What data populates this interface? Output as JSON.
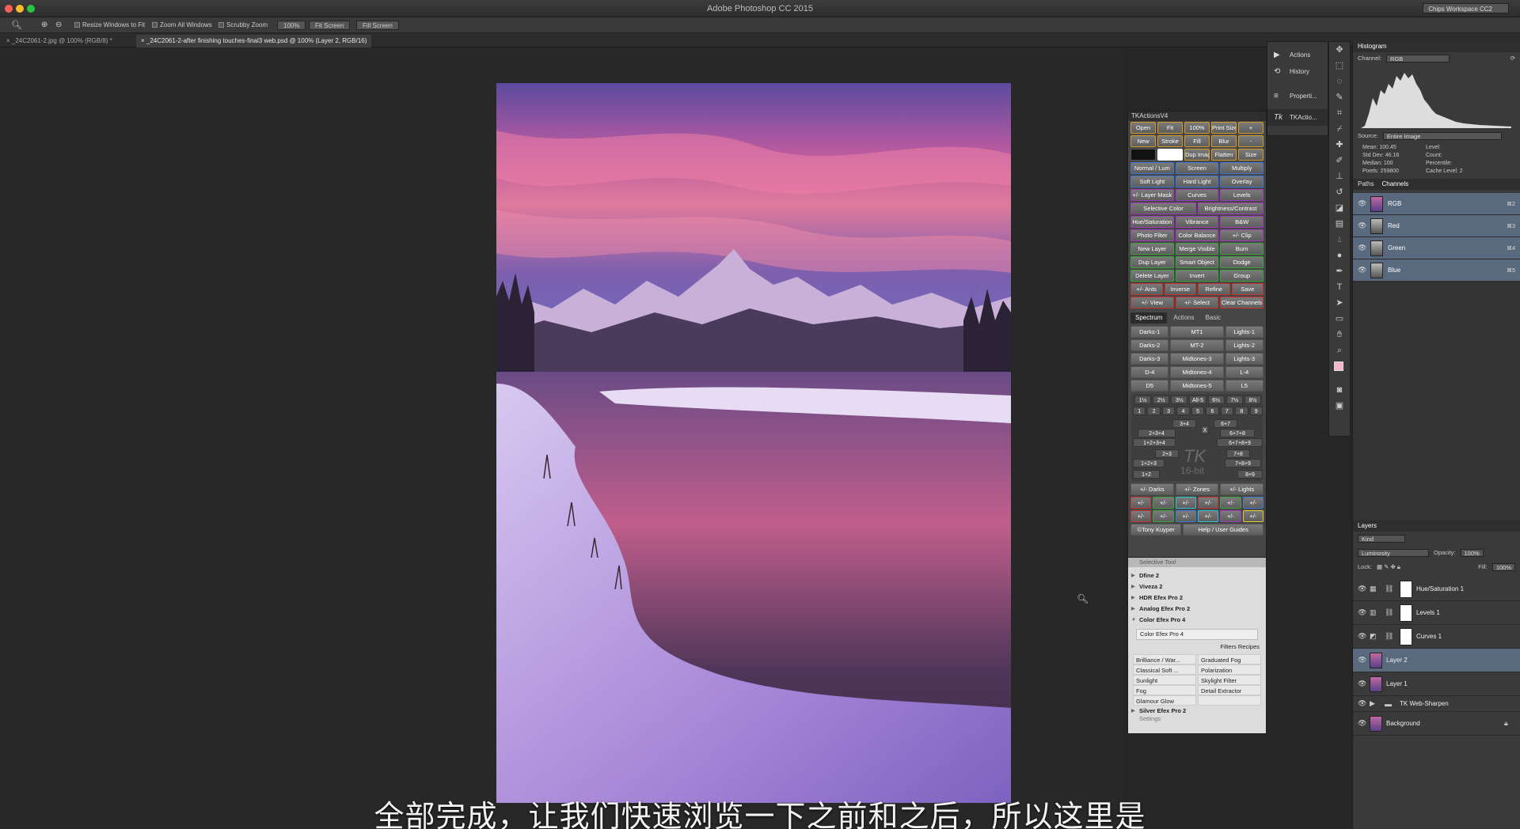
{
  "window": {
    "title": "Adobe Photoshop CC 2015",
    "workspace": "Chips Workspace CC2"
  },
  "options_bar": {
    "resize_windows": "Resize Windows to Fit",
    "zoom_all": "Zoom All Windows",
    "scrubby_zoom": "Scrubby Zoom",
    "zoom_value": "100%",
    "fit_screen": "Fit Screen",
    "fill_screen": "Fill Screen"
  },
  "tabs": [
    {
      "label": "_24C2061-2.jpg @ 100% (RGB/8) *"
    },
    {
      "label": "_24C2061-2-after finishing touches-final3 web.psd @ 100% (Layer 2, RGB/16)"
    }
  ],
  "subtitle": "全部完成，让我们快速浏览一下之前和之后，所以这里是",
  "tk": {
    "title": "TKActionsV4",
    "rows": [
      [
        {
          "t": "Open",
          "c": "o"
        },
        {
          "t": "Fit",
          "c": "o"
        },
        {
          "t": "100%",
          "c": "o"
        },
        {
          "t": "Print Size",
          "c": "o"
        },
        {
          "t": "+",
          "c": "o"
        }
      ],
      [
        {
          "t": "New",
          "c": "o"
        },
        {
          "t": "Stroke",
          "c": "o"
        },
        {
          "t": "Fill",
          "c": "o"
        },
        {
          "t": "Blur",
          "c": "o"
        },
        {
          "t": "-",
          "c": "o"
        }
      ],
      [
        {
          "t": "",
          "c": "k"
        },
        {
          "t": "",
          "c": "w"
        },
        {
          "t": "Dup Image",
          "c": "o"
        },
        {
          "t": "Flatten",
          "c": "o"
        },
        {
          "t": "Size",
          "c": "o"
        }
      ],
      [
        {
          "t": "Normal / Lum",
          "c": "bl"
        },
        {
          "t": "Screen",
          "c": "bl"
        },
        {
          "t": "Multiply",
          "c": "bl"
        }
      ],
      [
        {
          "t": "Soft Light",
          "c": "bl"
        },
        {
          "t": "Hard Light",
          "c": "bl"
        },
        {
          "t": "Overlay",
          "c": "bl"
        }
      ],
      [
        {
          "t": "+/- Layer Mask",
          "c": "pu"
        },
        {
          "t": "Curves",
          "c": "pu"
        },
        {
          "t": "Levels",
          "c": "pu"
        }
      ],
      [
        {
          "t": "Selective Color",
          "c": "pu"
        },
        {
          "t": "Brightness/Contrast",
          "c": "pu"
        }
      ],
      [
        {
          "t": "Hue/Saturation",
          "c": "pu"
        },
        {
          "t": "Vibrance",
          "c": "pu"
        },
        {
          "t": "B&W",
          "c": "pu"
        }
      ],
      [
        {
          "t": "Photo Filter",
          "c": "pu"
        },
        {
          "t": "Color Balance",
          "c": "pu"
        },
        {
          "t": "+/- Clip",
          "c": "pu"
        }
      ],
      [
        {
          "t": "New Layer",
          "c": "gr"
        },
        {
          "t": "Merge Visible",
          "c": "gr"
        },
        {
          "t": "Burn",
          "c": "gr"
        }
      ],
      [
        {
          "t": "Dup Layer",
          "c": "gr"
        },
        {
          "t": "Smart Object",
          "c": "gr"
        },
        {
          "t": "Dodge",
          "c": "gr"
        }
      ],
      [
        {
          "t": "Delete Layer",
          "c": "gr"
        },
        {
          "t": "Invert",
          "c": "gr"
        },
        {
          "t": "Group",
          "c": "gr"
        }
      ],
      [
        {
          "t": "+/- Ants",
          "c": "rd"
        },
        {
          "t": "Inverse",
          "c": "rd"
        },
        {
          "t": "Refine",
          "c": "rd"
        },
        {
          "t": "Save",
          "c": "rd"
        }
      ],
      [
        {
          "t": "+/- View",
          "c": "rd"
        },
        {
          "t": "+/- Select",
          "c": "rd"
        },
        {
          "t": "Clear Channels",
          "c": "rd"
        }
      ]
    ],
    "tabs": [
      "Spectrum",
      "Actions",
      "Basic"
    ],
    "spectrum_rows": [
      [
        "Darks-1",
        "MT1",
        "Lights-1"
      ],
      [
        "Darks-2",
        "MT-2",
        "Lights-2"
      ],
      [
        "Darks-3",
        "Midtones-3",
        "Lights-3"
      ],
      [
        "D-4",
        "Midtones-4",
        "L-4"
      ],
      [
        "D5",
        "Midtones-5",
        "L5"
      ]
    ],
    "pct_row": [
      "1½",
      "2½",
      "3½",
      "All-5",
      "6½",
      "7½",
      "8½"
    ],
    "num_row": [
      "1",
      "2",
      "3",
      "4",
      "5",
      "6",
      "7",
      "8",
      "9"
    ],
    "combos": [
      "3+4",
      "6+7",
      "2+3+4",
      "X",
      "6+7+8",
      "1+2+3+4",
      "6+7+8+9",
      "2+3",
      "7+8",
      "1+2+3",
      "7+8+9",
      "1+2",
      "8+9"
    ],
    "logo": "TK",
    "bitdepth": "16-bit",
    "zone_row": [
      "+/- Darks",
      "+/- Zones",
      "+/- Lights"
    ],
    "pm_row1": [
      {
        "t": "+/-",
        "c": "rd"
      },
      {
        "t": "+/-",
        "c": "gr"
      },
      {
        "t": "+/-",
        "c": "cy"
      },
      {
        "t": "+/-",
        "c": "rd"
      },
      {
        "t": "+/-",
        "c": "gr"
      },
      {
        "t": "+/-",
        "c": "bl"
      }
    ],
    "pm_row2": [
      {
        "t": "+/-",
        "c": "rd"
      },
      {
        "t": "+/-",
        "c": "gr"
      },
      {
        "t": "+/-",
        "c": "bl"
      },
      {
        "t": "+/-",
        "c": "cy"
      },
      {
        "t": "+/-",
        "c": "pu"
      },
      {
        "t": "+/-",
        "c": "yl"
      }
    ],
    "credit": "©Tony Kuyper",
    "help": "Help / User Guides"
  },
  "selective_tool": {
    "title": "Selective Tool",
    "items": [
      "Dfine 2",
      "Viveza 2",
      "HDR Efex Pro 2",
      "Analog Efex Pro 2",
      "Color Efex Pro 4"
    ],
    "sub": "Color Efex Pro 4",
    "tabs": [
      "Filters",
      "Recipes"
    ],
    "grid": [
      "Brilliance / War...",
      "Graduated Fog",
      "Classical Soft ...",
      "Polarization",
      "Sunlight",
      "Skylight Filter",
      "Fog",
      "Detail Extractor",
      "Glamour Glow",
      ""
    ],
    "next": "Silver Efex Pro 2",
    "settings": "Settings"
  },
  "dock": [
    {
      "icon": "▶",
      "label": "Actions"
    },
    {
      "icon": "⟲",
      "label": "History"
    },
    {
      "icon": "≡",
      "label": "Properti..."
    },
    {
      "icon": "Tk",
      "label": "TKActio..."
    }
  ],
  "histogram": {
    "title": "Histogram",
    "channel_label": "Channel:",
    "channel": "RGB",
    "source_label": "Source:",
    "source": "Entire Image",
    "stats": [
      [
        "Mean: 100.45",
        "Level:"
      ],
      [
        "Std Dev: 46.16",
        "Count:"
      ],
      [
        "Median: 100",
        "Percentile:"
      ],
      [
        "Pixels: 259800",
        "Cache Level: 2"
      ]
    ]
  },
  "channels_panel": {
    "tabs": [
      "Paths",
      "Channels"
    ],
    "rows": [
      {
        "name": "RGB",
        "key": "⌘2"
      },
      {
        "name": "Red",
        "key": "⌘3"
      },
      {
        "name": "Green",
        "key": "⌘4"
      },
      {
        "name": "Blue",
        "key": "⌘5"
      }
    ]
  },
  "layers_panel": {
    "title": "Layers",
    "kind": "Kind",
    "blend": "Luminosity",
    "opacity_label": "Opacity:",
    "opacity": "100%",
    "lock_label": "Lock:",
    "fill_label": "Fill:",
    "fill": "100%",
    "layers": [
      {
        "name": "Hue/Saturation 1",
        "type": "adj",
        "icon": "▦"
      },
      {
        "name": "Levels 1",
        "type": "adj",
        "icon": "▥"
      },
      {
        "name": "Curves 1",
        "type": "adj",
        "icon": "◩"
      },
      {
        "name": "Layer 2",
        "type": "img",
        "selected": true
      },
      {
        "name": "Layer 1",
        "type": "img"
      },
      {
        "name": "TK Web-Sharpen",
        "type": "group"
      },
      {
        "name": "Background",
        "type": "img",
        "locked": true
      }
    ]
  }
}
